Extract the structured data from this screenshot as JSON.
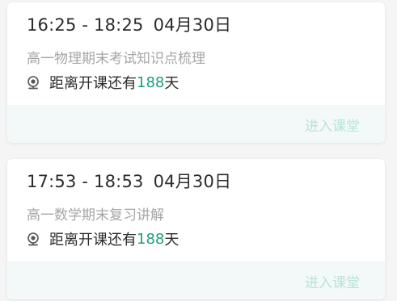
{
  "courses": [
    {
      "time_range": "16:25 - 18:25",
      "date": "04月30日",
      "title": "高一物理期末考试知识点梳理",
      "countdown_prefix": "距离开课还有",
      "countdown_days": "188",
      "countdown_suffix": "天",
      "enter_label": "进入课堂"
    },
    {
      "time_range": "17:53 - 18:53",
      "date": "04月30日",
      "title": "高一数学期末复习讲解",
      "countdown_prefix": "距离开课还有",
      "countdown_days": "188",
      "countdown_suffix": "天",
      "enter_label": "进入课堂"
    }
  ],
  "colors": {
    "accent": "#1e9d82",
    "button_text": "#b8e3da",
    "footer_bg": "#f3f8f8"
  },
  "icons": {
    "countdown": "webcam-icon"
  }
}
